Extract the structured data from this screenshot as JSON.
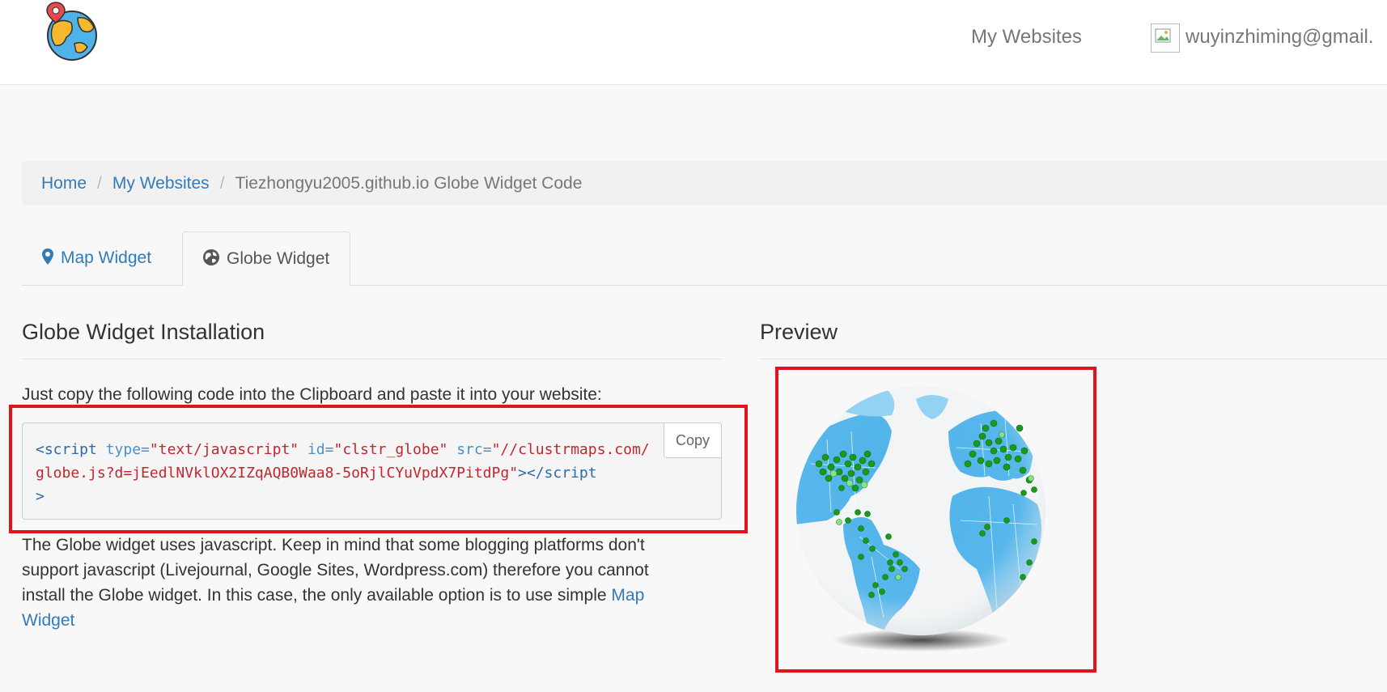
{
  "navbar": {
    "logo_icon": "globe-pin-logo",
    "my_websites": "My Websites",
    "user_email": "wuyinzhiming@gmail."
  },
  "breadcrumb": {
    "home": "Home",
    "sep": "/",
    "my_websites": "My Websites",
    "current": "Tiezhongyu2005.github.io Globe Widget Code"
  },
  "tabs": [
    {
      "label": "Map Widget",
      "icon": "map-marker-icon",
      "active": false
    },
    {
      "label": "Globe Widget",
      "icon": "globe-icon",
      "active": true
    }
  ],
  "install": {
    "heading": "Globe Widget Installation",
    "instructions": "Just copy the following code into the Clipboard and paste it into your website:",
    "code": {
      "open_tag": "<script",
      "attr_type": " type=",
      "val_type": "\"text/javascript\"",
      "attr_id": " id=",
      "val_id": "\"clstr_globe\"",
      "attr_src": " src=",
      "val_src": "\"//clustrmaps.com/globe.js?d=jEedlNVklOX2IZqAQB0Waa8-5oRjlCYuVpdX7PitdPg\"",
      "close": "></script",
      "end": ">"
    },
    "copy_label": "Copy",
    "description": "The Globe widget uses javascript. Keep in mind that some blogging platforms don't support javascript (Livejournal, Google Sites, Wordpress.com) therefore you cannot install the Globe widget. In this case, the only available option is to use simple ",
    "description_link": "Map Widget"
  },
  "preview": {
    "heading": "Preview",
    "globe_image": "clustrmaps-visitor-globe",
    "highlight_color": "#e1141e",
    "dot_color": "#1a9a1a",
    "ocean_color": "#4fb3ea"
  },
  "colors": {
    "link": "#337ab7",
    "highlight": "#e1141e"
  }
}
